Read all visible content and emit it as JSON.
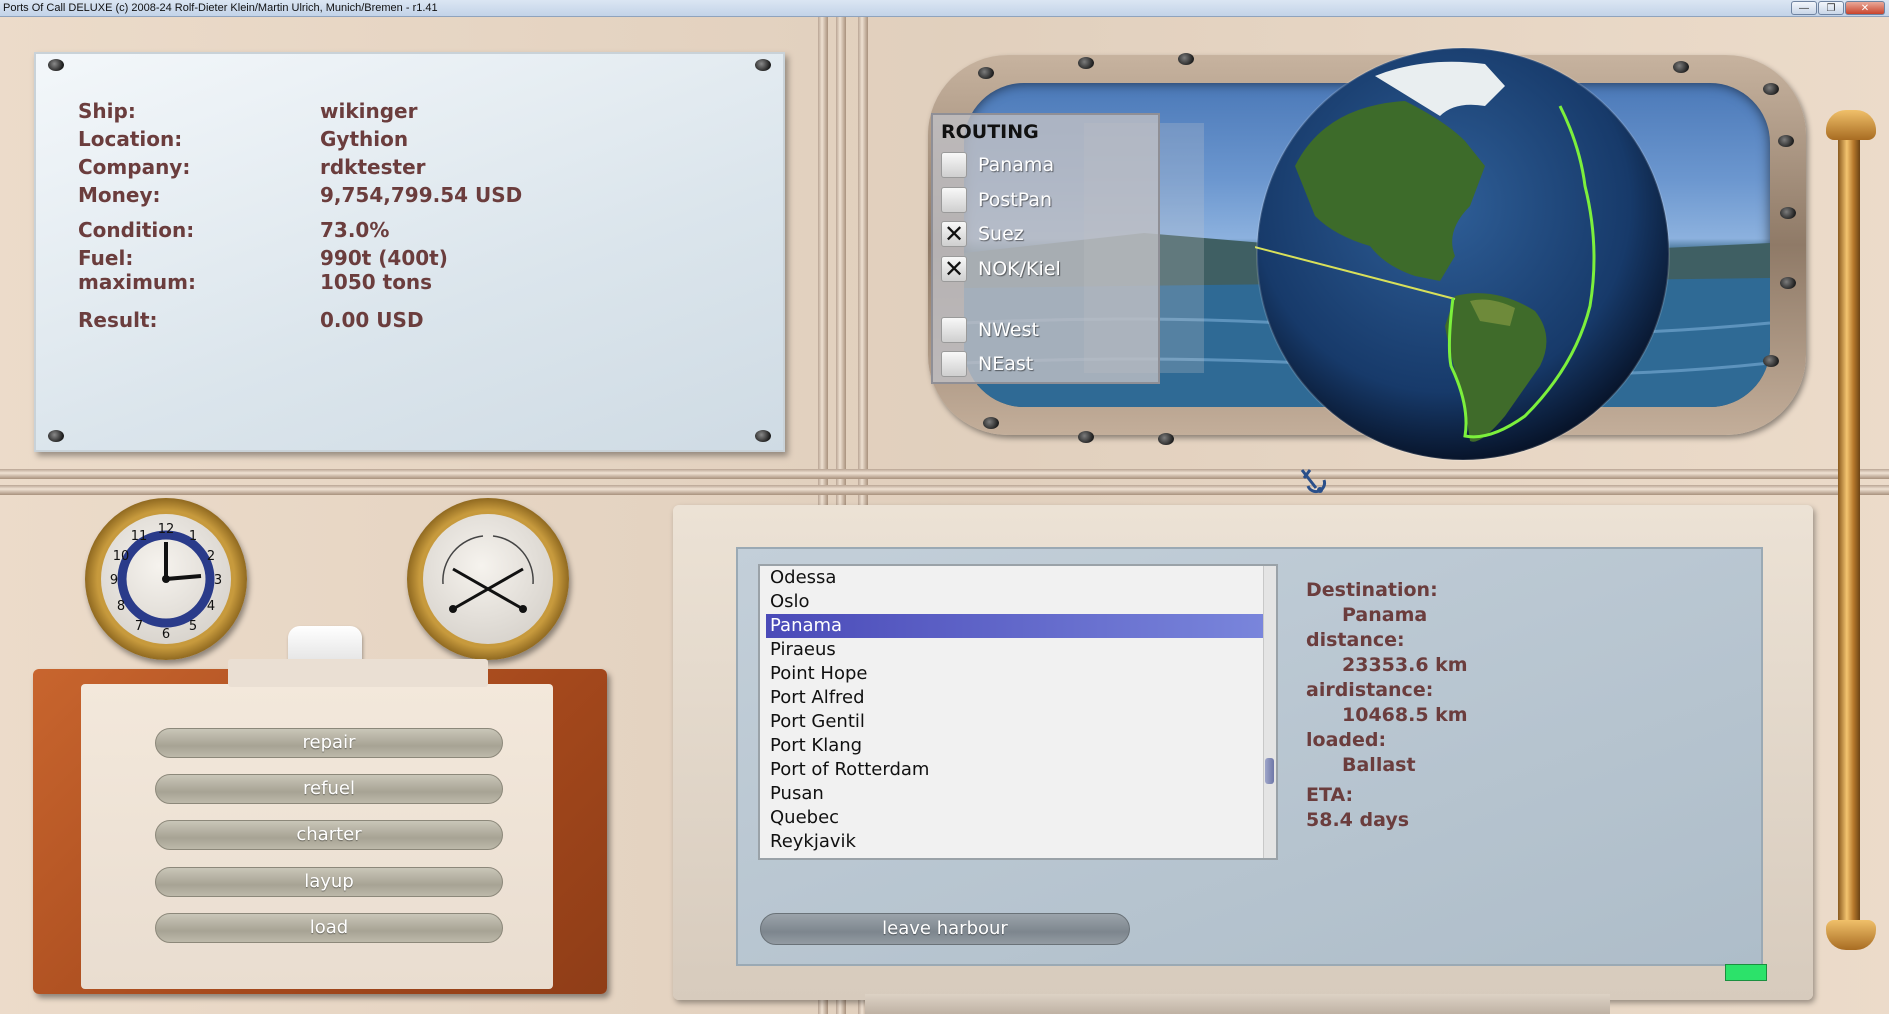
{
  "window": {
    "title": "Ports Of Call DELUXE (c) 2008-24 Rolf-Dieter Klein/Martin Ulrich, Munich/Bremen - r1.41",
    "buttons": [
      "—",
      "❐",
      "✕"
    ]
  },
  "ship_info": [
    {
      "label": "Ship:",
      "value": "wikinger"
    },
    {
      "label": "Location:",
      "value": "Gythion"
    },
    {
      "label": "Company:",
      "value": "rdktester"
    },
    {
      "label": "Money:",
      "value": "9,754,799.54 USD"
    },
    {
      "label": "Condition:",
      "value": "73.0%"
    },
    {
      "label": "Fuel:",
      "value": "990t (400t)"
    },
    {
      "label": "maximum:",
      "value": "1050 tons"
    },
    {
      "label": "Result:",
      "value": "0.00 USD"
    }
  ],
  "routing": {
    "title": "ROUTING",
    "options": [
      {
        "label": "Panama",
        "checked": false
      },
      {
        "label": "PostPan",
        "checked": false
      },
      {
        "label": "Suez",
        "checked": true
      },
      {
        "label": "NOK/Kiel",
        "checked": true
      },
      {
        "label": "NWest",
        "checked": false
      },
      {
        "label": "NEast",
        "checked": false
      }
    ]
  },
  "actions": {
    "repair": "repair",
    "refuel": "refuel",
    "charter": "charter",
    "layup": "layup",
    "load": "load"
  },
  "ports": [
    "Odessa",
    "Oslo",
    "Panama",
    "Piraeus",
    "Point Hope",
    "Port Alfred",
    "Port Gentil",
    "Port Klang",
    "Port of Rotterdam",
    "Pusan",
    "Quebec",
    "Reykjavik"
  ],
  "selected_port": "Panama",
  "destination": {
    "destination_label": "Destination:",
    "destination_value": "Panama",
    "distance_label": "distance:",
    "distance_value": "23353.6 km",
    "airdistance_label": "airdistance:",
    "airdistance_value": "10468.5 km",
    "loaded_label": "loaded:",
    "loaded_value": "Ballast",
    "eta_label": "ETA:",
    "eta_value": "58.4 days"
  },
  "leave_harbour": "leave harbour",
  "clock_numbers": [
    "12",
    "1",
    "2",
    "3",
    "4",
    "5",
    "6",
    "7",
    "8",
    "9",
    "10",
    "11"
  ],
  "colors": {
    "label_text": "#6b3d3d",
    "selection": "#4a4ab8",
    "route_line": "#7cf03c",
    "status_led": "#2ce26a"
  }
}
